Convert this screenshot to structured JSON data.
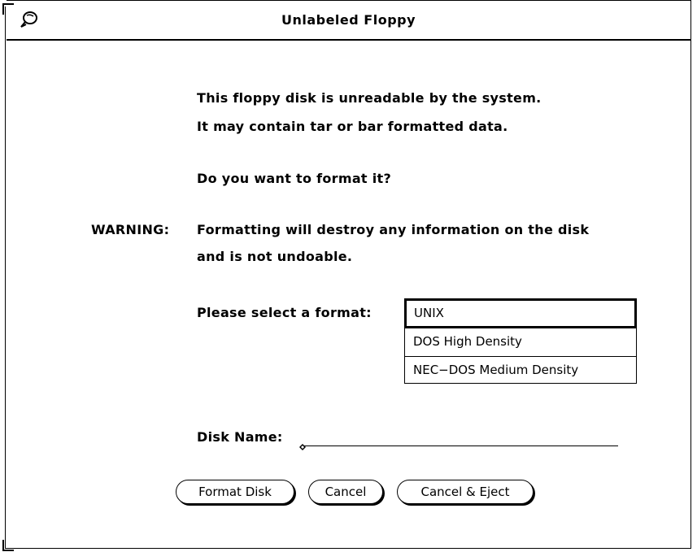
{
  "window": {
    "title": "Unlabeled Floppy",
    "menu_icon": "window-menu-icon"
  },
  "message": {
    "line1": "This floppy disk is unreadable by the system.",
    "line2": "It may contain tar or bar formatted data.",
    "question": "Do you want to format it?"
  },
  "warning": {
    "label": "WARNING:",
    "line1": "Formatting will destroy any information on the disk",
    "line2": "and is not undoable."
  },
  "format": {
    "label": "Please select a format:",
    "options": [
      "UNIX",
      "DOS High Density",
      "NEC−DOS Medium Density"
    ],
    "selected": "UNIX"
  },
  "disk_name": {
    "label": "Disk Name:",
    "value": ""
  },
  "buttons": {
    "format": "Format Disk",
    "cancel": "Cancel",
    "cancel_eject": "Cancel & Eject"
  }
}
